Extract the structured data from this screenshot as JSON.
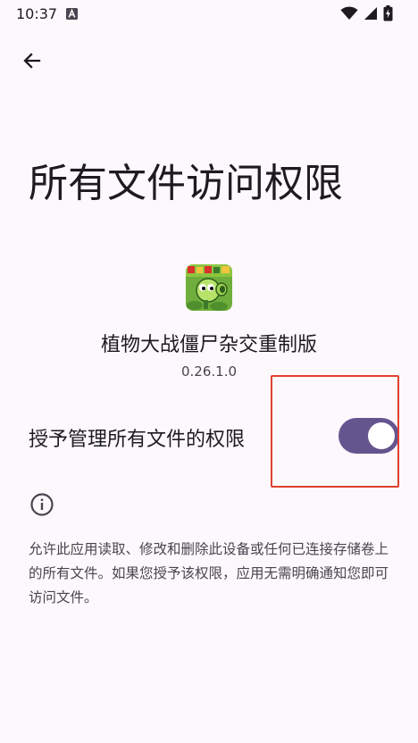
{
  "status_bar": {
    "time": "10:37",
    "notification_icon": "a-icon",
    "icons": [
      "wifi-icon",
      "signal-icon",
      "battery-charging-icon"
    ]
  },
  "header": {
    "back_icon": "arrow-back-icon"
  },
  "page": {
    "title": "所有文件访问权限",
    "app_name": "植物大战僵尸杂交重制版",
    "app_version": "0.26.1.0",
    "permission_label": "授予管理所有文件的权限",
    "permission_enabled": true,
    "info_icon": "info-icon",
    "description": "允许此应用读取、修改和删除此设备或任何已连接存储卷上的所有文件。如果您授予该权限，应用无需明确通知您即可访问文件。"
  },
  "colors": {
    "background": "#fcf8fc",
    "toggle_track": "#65558f",
    "highlight": "#e0402e"
  }
}
